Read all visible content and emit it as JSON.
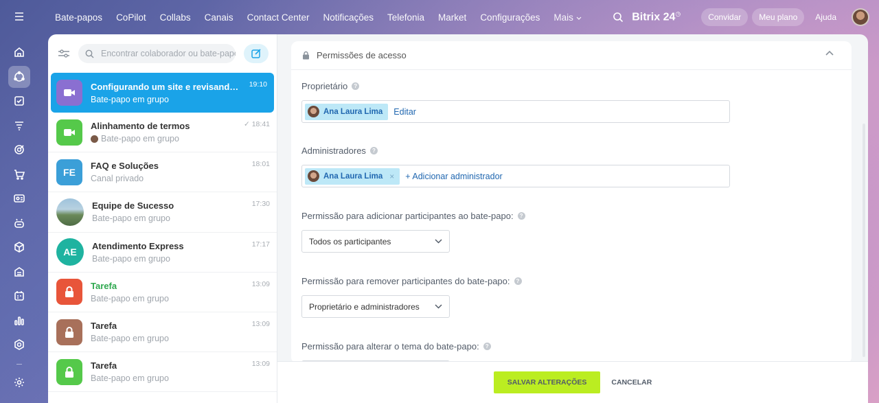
{
  "topnav": {
    "items": [
      "Bate-papos",
      "CoPilot",
      "Collabs",
      "Canais",
      "Contact Center",
      "Notificações",
      "Telefonia",
      "Market",
      "Configurações",
      "Mais"
    ],
    "brand": "Bitrix 24",
    "invite": "Convidar",
    "plan": "Meu plano",
    "help": "Ajuda"
  },
  "chatlist": {
    "search_placeholder": "Encontrar colaborador ou bate-papo",
    "items": [
      {
        "title": "Configurando um site e revisando os ...",
        "subtitle": "Bate-papo em grupo",
        "time": "19:10",
        "avatar_type": "video-icon",
        "color": "#8a6fd1",
        "active": true
      },
      {
        "title": "Alinhamento de termos",
        "subtitle": "Bate-papo em grupo",
        "time": "18:41",
        "avatar_type": "video-icon",
        "color": "#55c94a"
      },
      {
        "title": "FAQ e Soluções",
        "subtitle": "Canal privado",
        "time": "18:01",
        "avatar_type": "initials",
        "initials": "FE",
        "color": "#3b9fd8"
      },
      {
        "title": "Equipe de Sucesso",
        "subtitle": "Bate-papo em grupo",
        "time": "17:30",
        "avatar_type": "photo"
      },
      {
        "title": "Atendimento Express",
        "subtitle": "Bate-papo em grupo",
        "time": "17:17",
        "avatar_type": "initials",
        "initials": "AE",
        "color": "#1fb3a0"
      },
      {
        "title": "Tarefa",
        "subtitle": "Bate-papo em grupo",
        "time": "13:09",
        "avatar_type": "lock-icon",
        "color": "#e8553a",
        "green": true
      },
      {
        "title": "Tarefa",
        "subtitle": "Bate-papo em grupo",
        "time": "13:09",
        "avatar_type": "lock-icon",
        "color": "#a8705a"
      },
      {
        "title": "Tarefa",
        "subtitle": "Bate-papo em grupo",
        "time": "13:09",
        "avatar_type": "lock-icon",
        "color": "#55c94a"
      }
    ]
  },
  "settings": {
    "section_title": "Permissões de acesso",
    "owner_label": "Proprietário",
    "owner_name": "Ana Laura Lima",
    "owner_edit": "Editar",
    "admins_label": "Administradores",
    "admin_name": "Ana Laura Lima",
    "add_admin": "+ Adicionar administrador",
    "perm_add_label": "Permissão para adicionar participantes ao bate-papo:",
    "perm_add_value": "Todos os participantes",
    "perm_remove_label": "Permissão para remover participantes do bate-papo:",
    "perm_remove_value": "Proprietário e administradores",
    "perm_theme_label": "Permissão para alterar o tema do bate-papo:",
    "save": "SALVAR ALTERAÇÕES",
    "cancel": "CANCELAR"
  },
  "colors": {
    "accent": "#1aa3e8",
    "save": "#bbed21",
    "link": "#2067b0"
  }
}
